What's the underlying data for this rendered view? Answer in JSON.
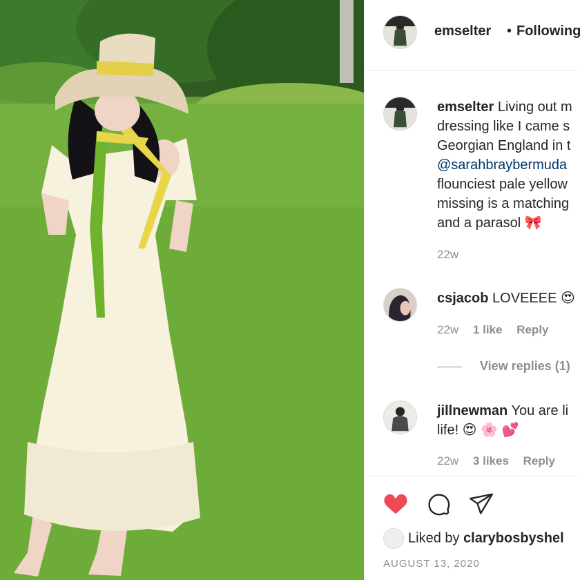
{
  "post": {
    "username": "emselter",
    "follow_status": "Following",
    "separator": "•"
  },
  "caption": {
    "username": "emselter",
    "lines": [
      "Living out m",
      "dressing like I came s",
      "Georgian England in t"
    ],
    "mention": "@sarahbraybermuda",
    "lines_after": [
      "flounciest pale yellow",
      "missing is a matching",
      "and a parasol 🎀"
    ],
    "time": "22w"
  },
  "comments": [
    {
      "username": "csjacob",
      "text": "LOVEEEE 😍",
      "time": "22w",
      "likes": "1 like",
      "reply": "Reply",
      "view_replies": "View replies (1)"
    },
    {
      "username": "jillnewman",
      "text": "You are li",
      "text2": "life! 😍 🌸 💕",
      "time": "22w",
      "likes": "3 likes",
      "reply": "Reply"
    }
  ],
  "actions": {
    "like_icon": "heart-filled-icon",
    "comment_icon": "comment-bubble-icon",
    "share_icon": "paper-plane-icon",
    "like_color": "#ed4956"
  },
  "liked_by": {
    "prefix": "Liked by ",
    "username": "clarybosbyshel"
  },
  "date": "AUGUST 13, 2020"
}
